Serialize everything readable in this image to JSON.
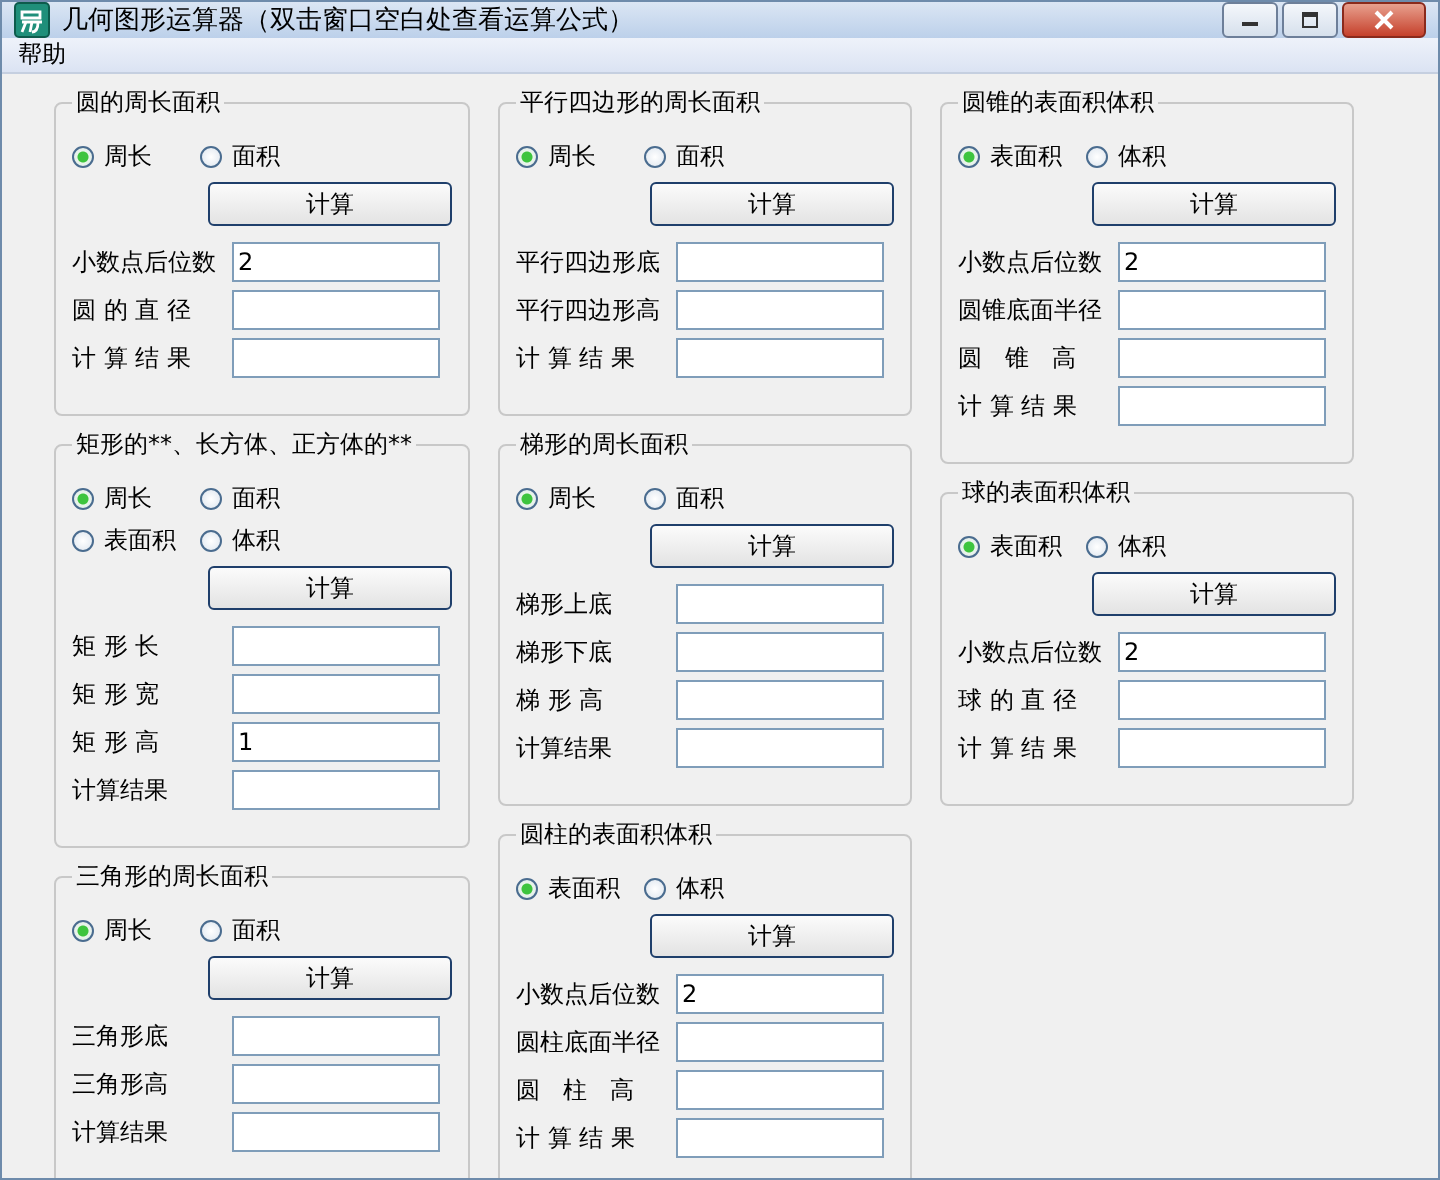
{
  "window": {
    "title": "几何图形运算器（双击窗口空白处查看运算公式）"
  },
  "menu": [
    "帮助"
  ],
  "columns": [
    [
      {
        "title": "圆的周长面积",
        "options": [
          {
            "label": "周长",
            "selected": true
          },
          {
            "label": "面积",
            "selected": false
          }
        ],
        "button": "计算",
        "fields": [
          {
            "label": "小数点后位数",
            "value": "2"
          },
          {
            "label": "圆 的 直 径"
          },
          {
            "label": "计 算 结 果"
          }
        ]
      },
      {
        "title": "矩形的**、长方体、正方体的**",
        "options": [
          {
            "label": "周长",
            "selected": true
          },
          {
            "label": "面积",
            "selected": false
          },
          {
            "label": "表面积",
            "selected": false
          },
          {
            "label": "体积",
            "selected": false
          }
        ],
        "button": "计算",
        "fields": [
          {
            "label": "矩 形 长"
          },
          {
            "label": "矩 形 宽"
          },
          {
            "label": "矩 形 高",
            "value": "1"
          },
          {
            "label": "计算结果"
          }
        ]
      },
      {
        "title": "三角形的周长面积",
        "options": [
          {
            "label": "周长",
            "selected": true
          },
          {
            "label": "面积",
            "selected": false
          }
        ],
        "button": "计算",
        "fields": [
          {
            "label": "三角形底"
          },
          {
            "label": "三角形高"
          },
          {
            "label": "计算结果"
          }
        ]
      }
    ],
    [
      {
        "title": "平行四边形的周长面积",
        "options": [
          {
            "label": "周长",
            "selected": true
          },
          {
            "label": "面积",
            "selected": false
          }
        ],
        "button": "计算",
        "fields": [
          {
            "label": "平行四边形底"
          },
          {
            "label": "平行四边形高"
          },
          {
            "label": "计 算 结 果"
          }
        ]
      },
      {
        "title": "梯形的周长面积",
        "options": [
          {
            "label": "周长",
            "selected": true
          },
          {
            "label": "面积",
            "selected": false
          }
        ],
        "button": "计算",
        "fields": [
          {
            "label": "梯形上底"
          },
          {
            "label": "梯形下底"
          },
          {
            "label": "梯 形 高"
          },
          {
            "label": "计算结果"
          }
        ]
      },
      {
        "title": "圆柱的表面积体积",
        "options": [
          {
            "label": "表面积",
            "selected": true
          },
          {
            "label": "体积",
            "selected": false
          }
        ],
        "button": "计算",
        "fields": [
          {
            "label": "小数点后位数",
            "value": "2"
          },
          {
            "label": "圆柱底面半径"
          },
          {
            "label": "圆   柱   高"
          },
          {
            "label": "计 算 结 果"
          }
        ]
      }
    ],
    [
      {
        "title": "圆锥的表面积体积",
        "options": [
          {
            "label": "表面积",
            "selected": true
          },
          {
            "label": "体积",
            "selected": false
          }
        ],
        "button": "计算",
        "fields": [
          {
            "label": "小数点后位数",
            "value": "2"
          },
          {
            "label": "圆锥底面半径"
          },
          {
            "label": "圆   锥   高"
          },
          {
            "label": "计 算 结 果"
          }
        ]
      },
      {
        "title": "球的表面积体积",
        "options": [
          {
            "label": "表面积",
            "selected": true
          },
          {
            "label": "体积",
            "selected": false
          }
        ],
        "button": "计算",
        "fields": [
          {
            "label": "小数点后位数",
            "value": "2"
          },
          {
            "label": "球 的 直 径"
          },
          {
            "label": "计 算 结 果"
          }
        ]
      }
    ]
  ]
}
